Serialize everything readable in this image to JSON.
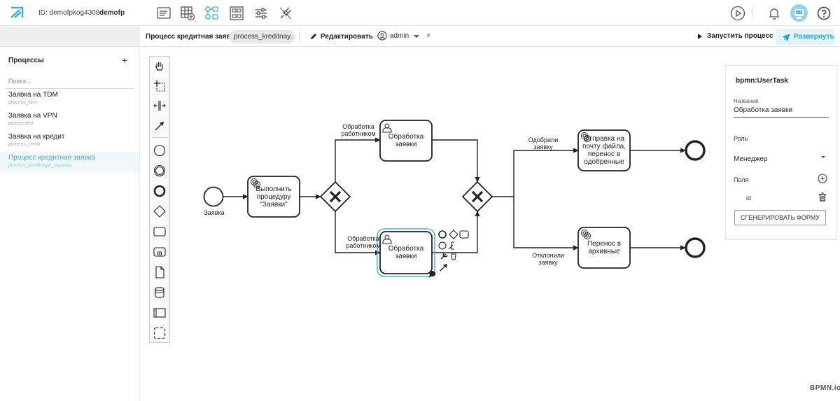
{
  "header": {
    "account_id": "ID: demofpkog4308",
    "account_name": "demofp"
  },
  "subbar": {
    "process_title": "Процесс кредитная заявка",
    "process_chip": "process_kreditnay...",
    "edit_label": "Редактировать",
    "user_label": "admin",
    "close_label": "×",
    "run_label": "Запустить процесс",
    "deploy_label": "Развернуть"
  },
  "sidebar": {
    "title": "Процессы",
    "add_label": "+",
    "search_placeholder": "Поиск...",
    "items": [
      {
        "title": "Заявка на TDM",
        "sub": "process_tdm"
      },
      {
        "title": "Заявка на VPN",
        "sub": "processtest"
      },
      {
        "title": "Заявка на кредит",
        "sub": "process_credit"
      },
      {
        "title": "Процесс кредитная заявка",
        "sub": "process_kreditnaya_zayavka"
      }
    ]
  },
  "diagram": {
    "start_label": "Заявка",
    "task_service": "Выполнить процедуру \"Заявки\"",
    "task_user_top": "Обработка заявки",
    "task_user_bottom": "Обработка заявки",
    "flow_top": "Обработка работником",
    "flow_bottom": "Обработка работником",
    "task_mail": "Отправка на почту файла, перенос в одобренные",
    "task_archive": "Перенос в архивные",
    "flow_approved": "Одобрили заявку",
    "flow_rejected": "Отклонили заявку"
  },
  "props": {
    "type": "bpmn:UserTask",
    "name_label": "Название",
    "name_value": "Обработка заявки",
    "role_label": "Роль",
    "role_value": "Менеджер",
    "fields_label": "Поля",
    "field_id": "id",
    "generate_label": "СГЕНЕРИРОВАТЬ ФОРМУ"
  },
  "watermark": "BPMN.io",
  "colors": {
    "accent": "#3aaedf",
    "selection": "#4fb0e0",
    "deploy_bg": "#e3f4fa"
  }
}
